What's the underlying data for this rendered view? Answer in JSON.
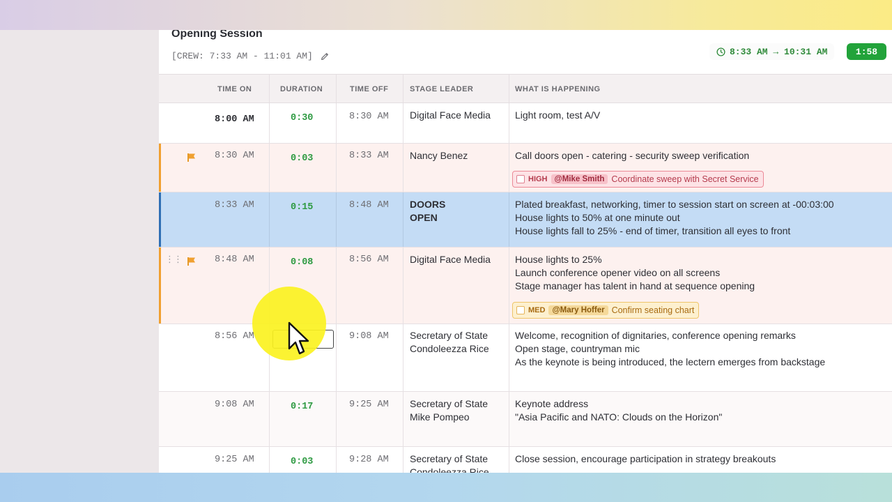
{
  "session": {
    "title": "Opening Session",
    "crew": "[CREW: 7:33 AM - 11:01 AM]",
    "time_range": "8:33 AM → 10:31 AM",
    "elapsed": "1:58"
  },
  "columns": [
    "TIME ON",
    "DURATION",
    "TIME OFF",
    "STAGE LEADER",
    "WHAT IS HAPPENING"
  ],
  "rows": [
    {
      "time_on": "8:00 AM",
      "duration": "0:30",
      "time_off": "8:30 AM",
      "leader": [
        "Digital Face Media"
      ],
      "happening": [
        "Light room, test A/V"
      ]
    },
    {
      "time_on": "8:30 AM",
      "duration": "0:03",
      "time_off": "8:33 AM",
      "leader": [
        "Nancy Benez"
      ],
      "happening": [
        "Call doors open - catering - security sweep verification"
      ],
      "task": {
        "priority": "HIGH",
        "assignee": "@Mike Smith",
        "text": "Coordinate sweep with Secret Service"
      }
    },
    {
      "time_on": "8:33 AM",
      "duration": "0:15",
      "time_off": "8:48 AM",
      "leader": [
        "DOORS",
        "OPEN"
      ],
      "happening": [
        "Plated breakfast, networking, timer to session start on screen at -00:03:00",
        "House lights to 50% at one minute out",
        "House lights fall to 25% - end of timer, transition all eyes to front"
      ]
    },
    {
      "time_on": "8:48 AM",
      "duration": "0:08",
      "time_off": "8:56 AM",
      "leader": [
        "Digital Face Media"
      ],
      "happening": [
        "House lights to 25%",
        "Launch conference opener video on all screens",
        "Stage manager has talent in hand at sequence opening"
      ],
      "task": {
        "priority": "MED",
        "assignee": "@Mary Hoffer",
        "text": "Confirm seating chart"
      }
    },
    {
      "time_on": "8:56 AM",
      "duration": "",
      "time_off": "9:08 AM",
      "leader": [
        "Secretary of State",
        "Condoleezza Rice"
      ],
      "happening": [
        "Welcome, recognition of dignitaries, conference opening remarks",
        "Open stage, countryman mic",
        "As the keynote is being introduced, the lectern emerges from backstage"
      ]
    },
    {
      "time_on": "9:08 AM",
      "duration": "0:17",
      "time_off": "9:25 AM",
      "leader": [
        "Secretary of State",
        "Mike Pompeo"
      ],
      "happening": [
        "Keynote address",
        "\"Asia Pacific and NATO: Clouds on the Horizon\""
      ]
    },
    {
      "time_on": "9:25 AM",
      "duration": "0:03",
      "time_off": "9:28 AM",
      "leader": [
        "Secretary of State",
        "Condoleezza Rice"
      ],
      "happening": [
        "Close session, encourage participation in strategy breakouts"
      ]
    }
  ],
  "colors": {
    "accent_green": "#22a33a",
    "flag_orange": "#f0a030",
    "high_red": "#e05060",
    "active_blue": "#c4dcf5"
  }
}
